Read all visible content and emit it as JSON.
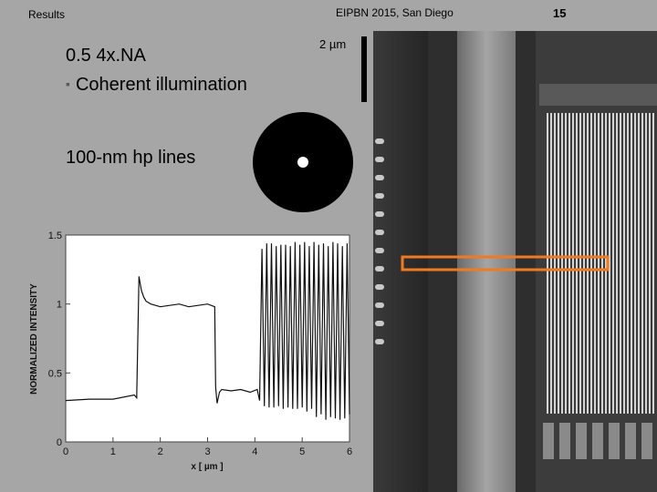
{
  "header": {
    "section": "Results",
    "conference": "EIPBN 2015, San Diego",
    "page_number": "15"
  },
  "text": {
    "title": "0.5 4x.NA",
    "bullet": "Coherent illumination",
    "lines_label": "100-nm hp lines"
  },
  "sem": {
    "scale_label": "2 µm",
    "highlight_color": "#f07a22"
  },
  "colors": {
    "background": "#a6a6a6",
    "highlight": "#f07a22"
  },
  "chart_data": {
    "type": "line",
    "xlabel": "x [ µm ]",
    "ylabel": "NORMALIZED INTENSITY",
    "xlim": [
      0,
      6
    ],
    "ylim": [
      0,
      1.5
    ],
    "x_ticks": [
      "0",
      "1",
      "2",
      "3",
      "4",
      "5",
      "6"
    ],
    "y_ticks": [
      "0",
      "0.5",
      "1",
      "1.5"
    ],
    "grid": false,
    "series": [
      {
        "x": [
          0,
          0.5,
          1.0,
          1.45,
          1.5,
          1.55,
          1.6,
          1.65,
          1.7,
          1.8,
          2.0,
          2.2,
          2.4,
          2.6,
          2.8,
          3.0,
          3.15,
          3.17,
          3.2,
          3.25,
          3.3,
          3.5,
          3.7,
          3.9,
          4.05,
          4.1,
          4.15,
          4.2,
          4.25,
          4.3,
          4.35,
          4.4,
          4.45,
          4.5,
          4.55,
          4.6,
          4.65,
          4.7,
          4.75,
          4.8,
          4.85,
          4.9,
          4.95,
          5.0,
          5.05,
          5.1,
          5.15,
          5.2,
          5.25,
          5.3,
          5.35,
          5.4,
          5.45,
          5.5,
          5.55,
          5.6,
          5.65,
          5.7,
          5.75,
          5.8,
          5.85,
          5.9,
          5.95,
          6.0
        ],
        "y": [
          0.3,
          0.31,
          0.31,
          0.34,
          0.32,
          1.2,
          1.1,
          1.05,
          1.02,
          1.0,
          0.98,
          0.99,
          1.0,
          0.98,
          0.99,
          1.0,
          0.98,
          0.4,
          0.28,
          0.36,
          0.38,
          0.37,
          0.38,
          0.36,
          0.38,
          0.3,
          1.4,
          0.26,
          1.44,
          0.25,
          1.44,
          0.25,
          1.42,
          0.26,
          1.43,
          0.24,
          1.43,
          0.25,
          1.42,
          0.24,
          1.45,
          0.24,
          1.43,
          0.25,
          1.45,
          0.22,
          1.42,
          0.24,
          1.45,
          0.18,
          1.43,
          0.2,
          1.44,
          0.16,
          1.42,
          0.18,
          1.45,
          0.17,
          1.44,
          0.16,
          1.42,
          0.17,
          1.44,
          0.2
        ]
      }
    ]
  }
}
